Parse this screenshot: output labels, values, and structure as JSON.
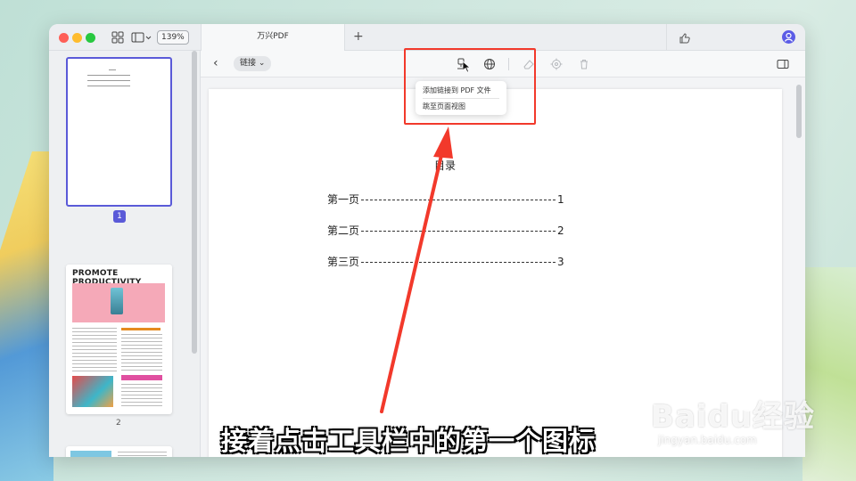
{
  "titlebar": {
    "zoom": "139%",
    "tab_title": "万兴PDF",
    "add_tab": "+"
  },
  "sidebar": {
    "page1_number": "1",
    "page2_number": "2",
    "page2_title": "PROMOTE PRODUCTIVITY"
  },
  "toolbar": {
    "back": "‹",
    "link_mode": "链接 ⌄"
  },
  "popover": {
    "item1": "添加链接到 PDF 文件",
    "item2": "跳至页面视图"
  },
  "document": {
    "toc_title": "目录",
    "entries": [
      {
        "label": "第一页",
        "page": "1"
      },
      {
        "label": "第二页",
        "page": "2"
      },
      {
        "label": "第三页",
        "page": "3"
      }
    ]
  },
  "caption": "接着点击工具栏中的第一个图标",
  "watermark": {
    "main": "Baidu经验",
    "sub": "jingyan.baidu.com"
  },
  "colors": {
    "accent": "#5a5ad8",
    "annotation": "#f2392b"
  }
}
